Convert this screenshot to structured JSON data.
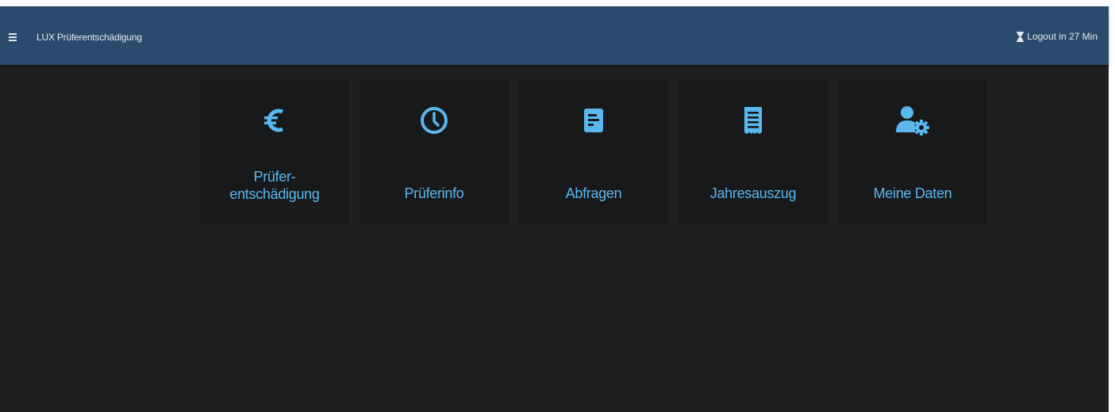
{
  "header": {
    "menu_icon": "hamburger-icon",
    "title": "LUX Prüferentschädigung",
    "logout_icon": "hourglass-icon",
    "logout_text": "Logout in 27 Min"
  },
  "colors": {
    "header_bg": "#2a4a6e",
    "page_bg": "#1f2022",
    "tile_bg": "#18191b",
    "accent": "#5ab8ee"
  },
  "tiles": [
    {
      "icon": "euro-icon",
      "label": "Prüfer-\nentschädigung"
    },
    {
      "icon": "clock-icon",
      "label": "Prüferinfo"
    },
    {
      "icon": "document-icon",
      "label": "Abfragen"
    },
    {
      "icon": "receipt-icon",
      "label": "Jahresauszug"
    },
    {
      "icon": "user-gear-icon",
      "label": "Meine Daten"
    }
  ]
}
